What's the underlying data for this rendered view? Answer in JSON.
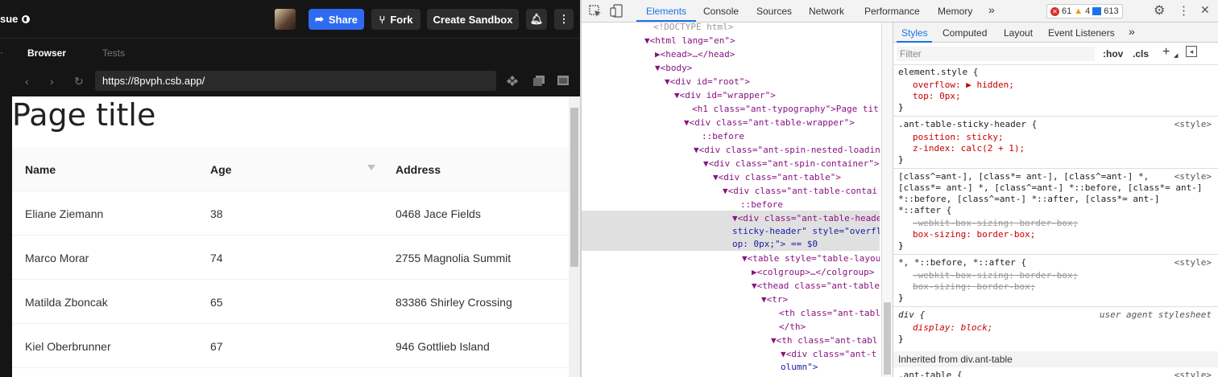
{
  "editor": {
    "title_fragment": "sue",
    "share_label": "Share",
    "fork_label": "Fork",
    "create_sandbox_label": "Create Sandbox",
    "tabs": [
      "Browser",
      "Tests"
    ],
    "url": "https://8pvph.csb.app/"
  },
  "preview": {
    "page_title": "Page title",
    "columns": [
      "Name",
      "Age",
      "Address"
    ],
    "rows": [
      {
        "name": "Eliane Ziemann",
        "age": "38",
        "address": "0468 Jace Fields"
      },
      {
        "name": "Marco Morar",
        "age": "74",
        "address": "2755 Magnolia Summit"
      },
      {
        "name": "Matilda Zboncak",
        "age": "65",
        "address": "83386 Shirley Crossing"
      },
      {
        "name": "Kiel Oberbrunner",
        "age": "67",
        "address": "946 Gottlieb Island"
      }
    ]
  },
  "devtools": {
    "tabs": [
      "Elements",
      "Console",
      "Sources",
      "Network",
      "Performance",
      "Memory"
    ],
    "more": "»",
    "errors": "61",
    "warnings": "4",
    "info": "613",
    "dom_lines": [
      "<!DOCTYPE html>",
      "▼<html lang=\"en\">",
      "▶<head>…</head>",
      "▼<body>",
      "▼<div id=\"root\">",
      "▼<div id=\"wrapper\">",
      "<h1 class=\"ant-typography\">Page titl",
      "▼<div class=\"ant-table-wrapper\">",
      "::before",
      "▼<div class=\"ant-spin-nested-loadin",
      "▼<div class=\"ant-spin-container\">",
      "▼<div class=\"ant-table\">",
      "▼<div class=\"ant-table-contai",
      "::before",
      "▼<div class=\"ant-table-heade",
      "sticky-header\" style=\"overfl",
      "op: 0px;\"> == $0",
      "▼<table style=\"table-layou",
      "▶<colgroup>…</colgroup>",
      "▼<thead class=\"ant-table",
      "▼<tr>",
      "<th class=\"ant-tabl",
      "</th>",
      "▼<th class=\"ant-tabl",
      "▼<div class=\"ant-t",
      "olumn\">"
    ],
    "styles_tabs": [
      "Styles",
      "Computed",
      "Layout",
      "Event Listeners",
      "»"
    ],
    "filter_placeholder": "Filter",
    "hov": ":hov",
    "cls": ".cls",
    "rules": {
      "r1_sel": "element.style {",
      "r1_p1": "overflow: ▶ hidden;",
      "r1_p2": "top: 0px;",
      "r2_sel": ".ant-table-sticky-header {",
      "r2_src": "<style>",
      "r2_p1": "position: sticky;",
      "r2_p2": "z-index: calc(2 + 1);",
      "r3_sel1": "[class^=ant-], [class*= ant-], [class^=ant-] *,",
      "r3_sel2": "[class*= ant-] *, [class^=ant-] *::before, [class*= ant-]",
      "r3_sel3": "*::before, [class^=ant-] *::after, [class*= ant-]",
      "r3_sel4": "*::after {",
      "r3_src": "<style>",
      "r3_p1": "-webkit-box-sizing: border-box;",
      "r3_p2": "box-sizing: border-box;",
      "r4_sel": "*, *::before, *::after {",
      "r4_src": "<style>",
      "r4_p1": "-webkit-box-sizing: border-box;",
      "r4_p2": "box-sizing: border-box;",
      "r5_sel": "div {",
      "r5_src": "user agent stylesheet",
      "r5_p1": "display: block;",
      "inherited": "Inherited from div.ant-table",
      "r6_sel": ".ant-table {",
      "r6_src": "<style>"
    },
    "close": "}"
  }
}
